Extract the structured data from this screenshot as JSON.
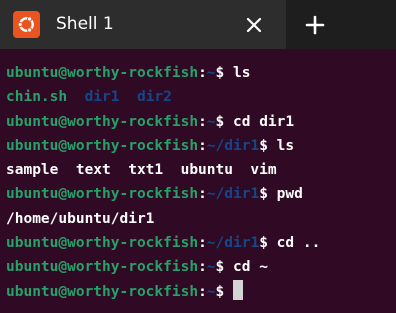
{
  "tab": {
    "title": "Shell 1",
    "close_icon": "close-icon",
    "new_tab_icon": "plus-icon",
    "app_icon": "ubuntu-icon"
  },
  "colors": {
    "background": "#300a24",
    "prompt_user": "#26a269",
    "path": "#12488b",
    "text": "#ffffff",
    "accent": "#e95420"
  },
  "terminal": {
    "prompt_user": "ubuntu@worthy-rockfish",
    "prompt_sep": ":",
    "home": "~",
    "dir1_path": "/dir1",
    "prompt_symbol": "$ ",
    "lines": [
      {
        "cmd": "ls",
        "path": "~"
      },
      {
        "output_files": [
          "chin.sh",
          "dir1",
          "dir2"
        ]
      },
      {
        "cmd": "cd dir1",
        "path": "~"
      },
      {
        "cmd": "ls",
        "path": "~/dir1"
      },
      {
        "output": "sample  text  txt1  ubuntu  vim"
      },
      {
        "cmd": "pwd",
        "path": "~/dir1"
      },
      {
        "output": "/home/ubuntu/dir1"
      },
      {
        "cmd": "cd ..",
        "path": "~/dir1"
      },
      {
        "cmd": "cd ~",
        "path": "~"
      },
      {
        "cmd": "",
        "path": "~"
      }
    ],
    "l1_cmd": "ls",
    "l2_file1": "chin.sh",
    "l2_dir1": "dir1",
    "l2_dir2": "dir2",
    "l3_cmd": "cd dir1",
    "l4_cmd": "ls",
    "l5_output": "sample  text  txt1  ubuntu  vim",
    "l6_cmd": "pwd",
    "l7_output": "/home/ubuntu/dir1",
    "l8_cmd": "cd ..",
    "l9_cmd": "cd ~"
  }
}
